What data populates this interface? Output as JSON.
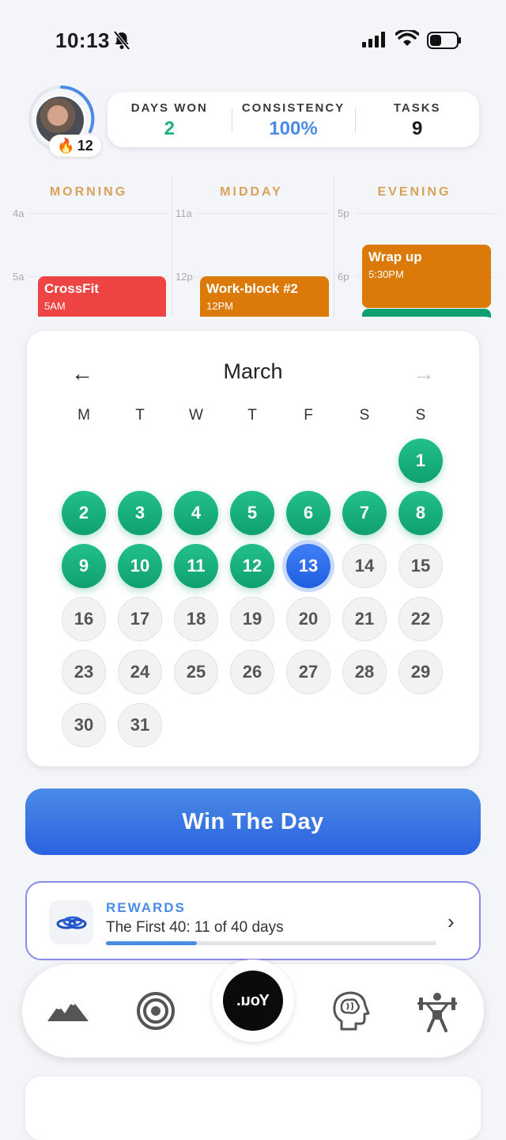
{
  "status_bar": {
    "time": "10:13",
    "icons": [
      "bell-slash-icon",
      "signal-icon",
      "wifi-icon",
      "battery-icon"
    ]
  },
  "header": {
    "streak_count": "12",
    "streak_icon": "fire-icon",
    "stats": [
      {
        "label": "DAYS WON",
        "value": "2",
        "color": "#22b07d"
      },
      {
        "label": "CONSISTENCY",
        "value": "100%",
        "color": "#4a8be6"
      },
      {
        "label": "TASKS",
        "value": "9",
        "color": "#1b1b1b"
      }
    ]
  },
  "schedule": {
    "columns": [
      "MORNING",
      "MIDDAY",
      "EVENING"
    ],
    "hour_labels": {
      "morning": [
        "4a",
        "5a"
      ],
      "midday": [
        "11a",
        "12p"
      ],
      "evening": [
        "5p",
        "6p"
      ]
    },
    "events": [
      {
        "title": "CrossFit",
        "time": "5AM",
        "color": "#ef4444"
      },
      {
        "title": "Work-block #2",
        "time": "12PM",
        "color": "#db7a08"
      },
      {
        "title": "Wrap up",
        "time": "5:30PM",
        "color": "#db7a08"
      }
    ]
  },
  "calendar": {
    "month": "March",
    "weekdays": [
      "M",
      "T",
      "W",
      "T",
      "F",
      "S",
      "S"
    ],
    "first_weekday_index": 6,
    "days_in_month": 31,
    "won_days": [
      1,
      2,
      3,
      4,
      5,
      6,
      7,
      8,
      9,
      10,
      11,
      12
    ],
    "today": 13
  },
  "win_button": {
    "label": "Win The Day"
  },
  "rewards": {
    "title": "REWARDS",
    "subtitle": "The First 40: 11 of 40 days",
    "progress": 0.275,
    "icon": "rings-icon"
  },
  "tab_bar": {
    "items": [
      "mountains-icon",
      "target-icon",
      "you-button",
      "brain-icon",
      "weightlifter-icon"
    ],
    "center_label": "You."
  }
}
